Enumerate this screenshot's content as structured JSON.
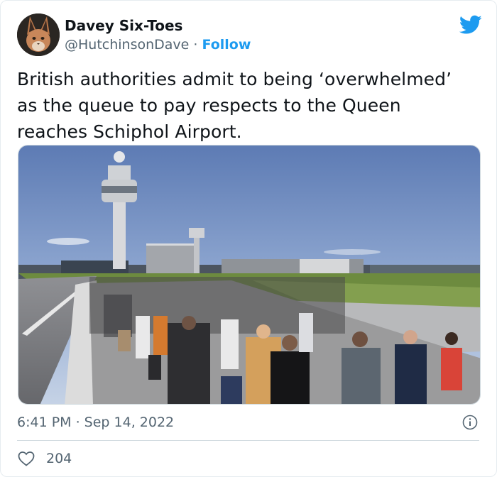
{
  "author": {
    "display_name": "Davey Six-Toes",
    "handle": "@HutchinsonDave",
    "separator": "·",
    "follow_label": "Follow"
  },
  "tweet": {
    "text_lines": [
      "British authorities admit to being ‘overwhelmed’",
      "as the queue to pay respects to the Queen",
      "reaches Schiphol Airport."
    ]
  },
  "meta": {
    "timestamp": "6:41 PM · Sep 14, 2022"
  },
  "engagement": {
    "likes": "204"
  },
  "icons": {
    "brand": "twitter-bird-icon",
    "info": "info-icon",
    "like": "heart-icon"
  },
  "colors": {
    "accent": "#1d9bf0",
    "secondary_text": "#536471",
    "primary_text": "#0f1419"
  }
}
